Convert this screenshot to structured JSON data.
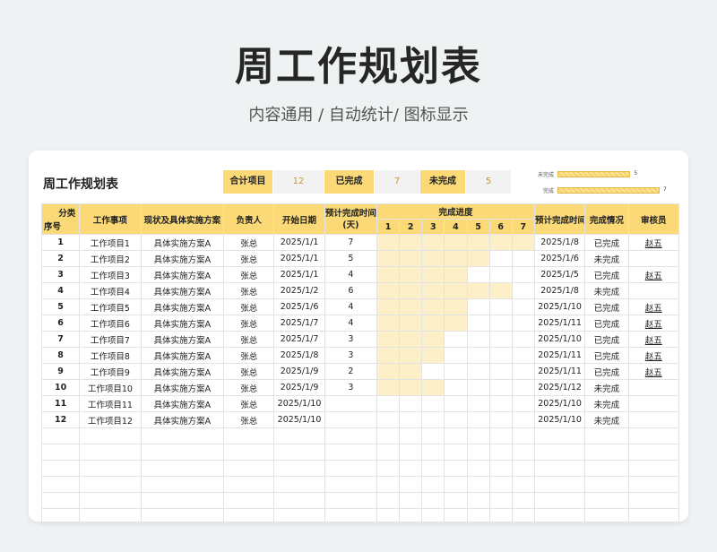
{
  "hero": {
    "title": "周工作规划表",
    "subtitle": "内容通用 / 自动统计/ 图标显示"
  },
  "sheet": {
    "title": "周工作规划表"
  },
  "summary": {
    "total_label": "合计项目",
    "total_value": "12",
    "done_label": "已完成",
    "done_value": "7",
    "undone_label": "未完成",
    "undone_value": "5"
  },
  "mini_chart": {
    "type": "bar",
    "categories": [
      "未完成",
      "完成"
    ],
    "values": [
      5,
      7
    ],
    "xlim": [
      0,
      7
    ]
  },
  "headers": {
    "category": "分类",
    "seq": "序号",
    "task": "工作事项",
    "plan": "现状及具体实施方案",
    "owner": "负责人",
    "start": "开始日期",
    "duration": "预计完成时间\n(天)",
    "progress": "完成进度",
    "days": [
      "1",
      "2",
      "3",
      "4",
      "5",
      "6",
      "7"
    ],
    "end": "预计完成时间",
    "status": "完成情况",
    "reviewer": "审核员"
  },
  "rows": [
    {
      "seq": "1",
      "task": "工作项目1",
      "plan": "具体实施方案A",
      "owner": "张总",
      "start": "2025/1/1",
      "days": "7",
      "end": "2025/1/8",
      "status": "已完成",
      "reviewer": "赵五"
    },
    {
      "seq": "2",
      "task": "工作项目2",
      "plan": "具体实施方案A",
      "owner": "张总",
      "start": "2025/1/1",
      "days": "5",
      "end": "2025/1/6",
      "status": "未完成",
      "reviewer": ""
    },
    {
      "seq": "3",
      "task": "工作项目3",
      "plan": "具体实施方案A",
      "owner": "张总",
      "start": "2025/1/1",
      "days": "4",
      "end": "2025/1/5",
      "status": "已完成",
      "reviewer": "赵五"
    },
    {
      "seq": "4",
      "task": "工作项目4",
      "plan": "具体实施方案A",
      "owner": "张总",
      "start": "2025/1/2",
      "days": "6",
      "end": "2025/1/8",
      "status": "未完成",
      "reviewer": ""
    },
    {
      "seq": "5",
      "task": "工作项目5",
      "plan": "具体实施方案A",
      "owner": "张总",
      "start": "2025/1/6",
      "days": "4",
      "end": "2025/1/10",
      "status": "已完成",
      "reviewer": "赵五"
    },
    {
      "seq": "6",
      "task": "工作项目6",
      "plan": "具体实施方案A",
      "owner": "张总",
      "start": "2025/1/7",
      "days": "4",
      "end": "2025/1/11",
      "status": "已完成",
      "reviewer": "赵五"
    },
    {
      "seq": "7",
      "task": "工作项目7",
      "plan": "具体实施方案A",
      "owner": "张总",
      "start": "2025/1/7",
      "days": "3",
      "end": "2025/1/10",
      "status": "已完成",
      "reviewer": "赵五"
    },
    {
      "seq": "8",
      "task": "工作项目8",
      "plan": "具体实施方案A",
      "owner": "张总",
      "start": "2025/1/8",
      "days": "3",
      "end": "2025/1/11",
      "status": "已完成",
      "reviewer": "赵五"
    },
    {
      "seq": "9",
      "task": "工作项目9",
      "plan": "具体实施方案A",
      "owner": "张总",
      "start": "2025/1/9",
      "days": "2",
      "end": "2025/1/11",
      "status": "已完成",
      "reviewer": "赵五"
    },
    {
      "seq": "10",
      "task": "工作项目10",
      "plan": "具体实施方案A",
      "owner": "张总",
      "start": "2025/1/9",
      "days": "3",
      "end": "2025/1/12",
      "status": "未完成",
      "reviewer": ""
    },
    {
      "seq": "11",
      "task": "工作项目11",
      "plan": "具体实施方案A",
      "owner": "张总",
      "start": "2025/1/10",
      "days": "",
      "end": "2025/1/10",
      "status": "未完成",
      "reviewer": ""
    },
    {
      "seq": "12",
      "task": "工作项目12",
      "plan": "具体实施方案A",
      "owner": "张总",
      "start": "2025/1/10",
      "days": "",
      "end": "2025/1/10",
      "status": "未完成",
      "reviewer": ""
    }
  ],
  "gantt_filled_days": [
    7,
    5,
    4,
    6,
    4,
    4,
    3,
    3,
    2,
    3,
    0,
    0
  ],
  "empty_row_count": 6
}
